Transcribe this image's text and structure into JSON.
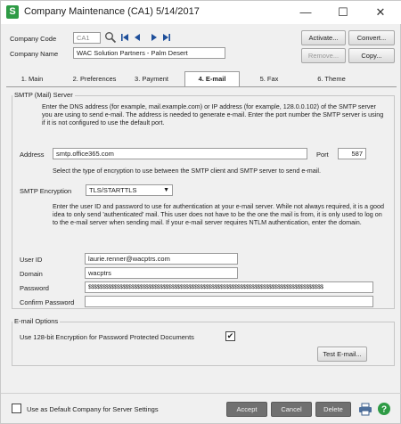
{
  "window": {
    "title": "Company Maintenance (CA1) 5/14/2017",
    "minimize_icon": "—",
    "maximize_icon": "☐",
    "close_icon": "✕"
  },
  "header": {
    "company_code_label": "Company Code",
    "company_code_value": "CA1",
    "company_name_label": "Company Name",
    "company_name_value": "WAC Solution Partners - Palm Desert",
    "activate_label": "Activate...",
    "convert_label": "Convert...",
    "remove_label": "Remove...",
    "copy_label": "Copy..."
  },
  "tabs": [
    {
      "label": "1. Main"
    },
    {
      "label": "2. Preferences"
    },
    {
      "label": "3. Payment"
    },
    {
      "label": "4. E-mail"
    },
    {
      "label": "5. Fax"
    },
    {
      "label": "6. Theme"
    }
  ],
  "smtp": {
    "group_title": "SMTP (Mail) Server",
    "intro_text": "Enter the DNS address (for example, mail.example.com) or IP address (for example, 128.0.0.102) of the SMTP server you are using to send e-mail. The address is needed to generate e-mail. Enter the port number the SMTP server is using if it is not configured to use the default port.",
    "address_label": "Address",
    "address_value": "smtp.office365.com",
    "port_label": "Port",
    "port_value": "587",
    "encryption_intro": "Select the type of encryption to use between the SMTP client and SMTP server to send e-mail.",
    "encryption_label": "SMTP Encryption",
    "encryption_value": "TLS/STARTTLS",
    "auth_text": "Enter the user ID and password to use for authentication at your e-mail server. While not always required, it is a good idea to only send 'authenticated' mail. This user does not have to be the one the mail is from, it is only used to log on to the e-mail server when sending mail. If your e-mail server requires NTLM authentication, enter the domain.",
    "user_id_label": "User ID",
    "user_id_value": "laurie.renner@wacptrs.com",
    "domain_label": "Domain",
    "domain_value": "wacptrs",
    "password_label": "Password",
    "password_value": "$$$$$$$$$$$$$$$$$$$$$$$$$$$$$$$$$$$$$$$$$$$$$$$$$$$$$$$$$$$$$$$$$$$$$$$$$$$$$$$$$$",
    "confirm_password_label": "Confirm Password",
    "confirm_password_value": ""
  },
  "email_options": {
    "group_title": "E-mail Options",
    "encryption_checkbox_label": "Use 128-bit Encryption for Password Protected Documents",
    "encryption_checked": "✔",
    "test_email_label": "Test E-mail..."
  },
  "footer": {
    "default_company_label": "Use as Default Company for Server Settings",
    "accept_label": "Accept",
    "cancel_label": "Cancel",
    "delete_label": "Delete"
  }
}
